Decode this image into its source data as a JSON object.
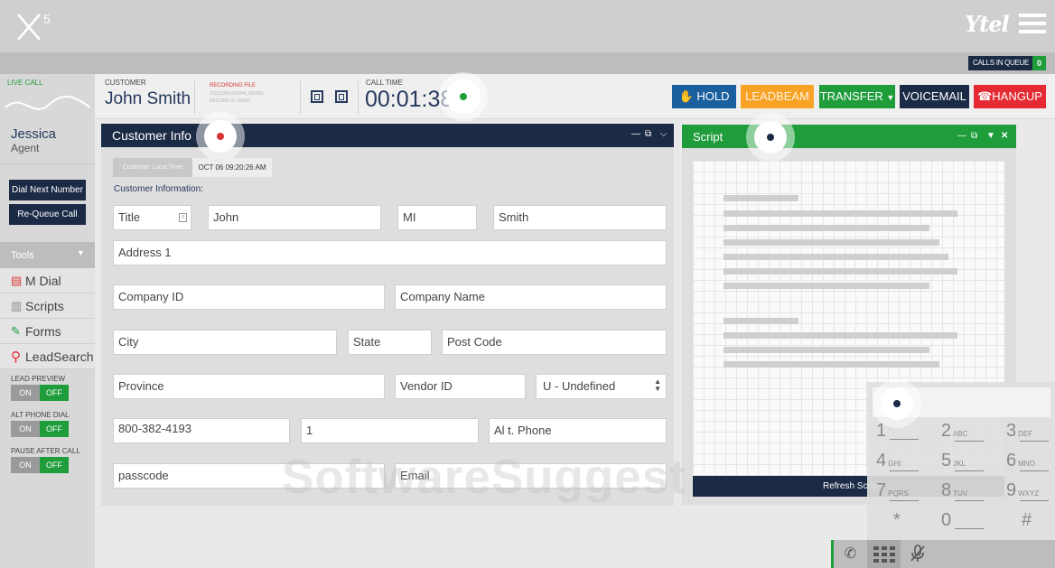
{
  "brand": {
    "logo": "X5",
    "partner_logo": "Ytel"
  },
  "queue": {
    "label": "CALLS IN QUEUE",
    "count": "0"
  },
  "call": {
    "live_label": "LIVE CALL",
    "customer_label": "CUSTOMER",
    "customer_name": "John Smith",
    "recording_label": "RECORDING FILE",
    "recording_line1": "20151006-093844_587951...",
    "recording_line2": "RECORD ID: 95660",
    "calltime_label": "CALL TIME",
    "calltime": "00:01:38"
  },
  "actions": {
    "hold": "HOLD",
    "leadbeam": "LEADBEAM",
    "transfer": "TRANSFER",
    "voicemail": "VOICEMAIL",
    "hangup": "HANGUP"
  },
  "agent": {
    "name": "Jessica",
    "role": "Agent"
  },
  "sidebar": {
    "dial_next": "Dial Next Number",
    "requeue": "Re-Queue Call",
    "tools": "Tools",
    "menu": [
      "M Dial",
      "Scripts",
      "Forms",
      "LeadSearch"
    ],
    "toggles": [
      {
        "label": "LEAD PREVIEW",
        "on": "ON",
        "off": "OFF"
      },
      {
        "label": "ALT PHONE DIAL",
        "on": "ON",
        "off": "OFF"
      },
      {
        "label": "PAUSE AFTER CALL",
        "on": "ON",
        "off": "OFF"
      }
    ]
  },
  "customer_info": {
    "title": "Customer Info",
    "local_time_label": "Customer Local Time",
    "local_time": "OCT 06 09:20:26 AM",
    "section_label": "Customer Information:",
    "fields": {
      "title": "Title",
      "first_name": "John",
      "mi": "MI",
      "last_name": "Smith",
      "address1": "Address 1",
      "company_id": "Company ID",
      "company_name": "Company Name",
      "city": "City",
      "state": "State",
      "post_code": "Post Code",
      "province": "Province",
      "vendor_id": "Vendor ID",
      "undefined_select": "U - Undefined",
      "phone": "800-382-4193",
      "phone_code": "1",
      "alt_phone": "Al t. Phone",
      "passcode": "passcode",
      "email": "Email"
    }
  },
  "script": {
    "title": "Script",
    "refresh": "Refresh Script"
  },
  "dialpad": {
    "keys": [
      {
        "digit": "1",
        "letters": ""
      },
      {
        "digit": "2",
        "letters": "ABC"
      },
      {
        "digit": "3",
        "letters": "DEF"
      },
      {
        "digit": "4",
        "letters": "GHI"
      },
      {
        "digit": "5",
        "letters": "JKL"
      },
      {
        "digit": "6",
        "letters": "MNO"
      },
      {
        "digit": "7",
        "letters": "PQRS"
      },
      {
        "digit": "8",
        "letters": "TUV"
      },
      {
        "digit": "9",
        "letters": "WXYZ"
      },
      {
        "digit": "*",
        "letters": ""
      },
      {
        "digit": "0",
        "letters": ""
      },
      {
        "digit": "#",
        "letters": ""
      }
    ]
  },
  "watermark": "SoftwareSuggest",
  "colors": {
    "navy": "#1b2a45",
    "green": "#1f9d3b",
    "orange": "#f8a326",
    "red": "#e62a33",
    "blue": "#1a5f9e"
  }
}
